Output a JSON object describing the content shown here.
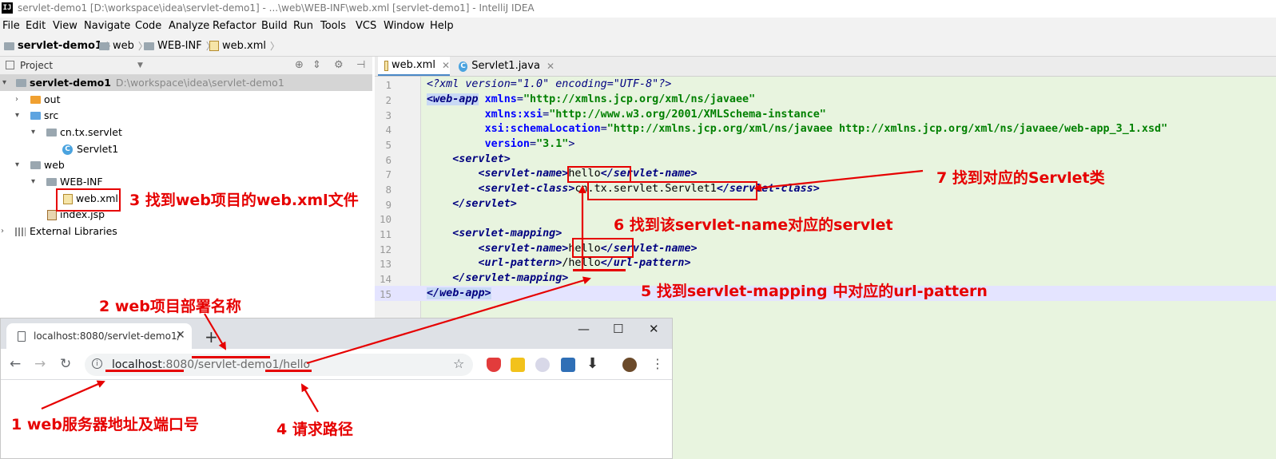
{
  "window": {
    "title": "servlet-demo1 [D:\\workspace\\idea\\servlet-demo1] - ...\\web\\WEB-INF\\web.xml [servlet-demo1] - IntelliJ IDEA",
    "logo_text": "IJ"
  },
  "menu": [
    "File",
    "Edit",
    "View",
    "Navigate",
    "Code",
    "Analyze",
    "Refactor",
    "Build",
    "Run",
    "Tools",
    "VCS",
    "Window",
    "Help"
  ],
  "breadcrumb": [
    "servlet-demo1",
    "web",
    "WEB-INF",
    "web.xml"
  ],
  "project_panel": {
    "title": "Project",
    "tree": [
      {
        "label": "servlet-demo1",
        "path": "D:\\workspace\\idea\\servlet-demo1"
      },
      {
        "label": "out"
      },
      {
        "label": "src"
      },
      {
        "label": "cn.tx.servlet"
      },
      {
        "label": "Servlet1"
      },
      {
        "label": "web"
      },
      {
        "label": "WEB-INF"
      },
      {
        "label": "web.xml"
      },
      {
        "label": "index.jsp"
      },
      {
        "label": "External Libraries"
      }
    ]
  },
  "editor": {
    "tabs": [
      {
        "label": "web.xml",
        "active": true
      },
      {
        "label": "Servlet1.java",
        "active": false
      }
    ],
    "line_numbers": [
      "1",
      "2",
      "3",
      "4",
      "5",
      "6",
      "7",
      "8",
      "9",
      "10",
      "11",
      "12",
      "13",
      "14",
      "15"
    ]
  },
  "browser": {
    "tab_title": "localhost:8080/servlet-demo1/",
    "url_host": "localhost",
    "url_rest": ":8080/servlet-demo1/hello",
    "new_tab_glyph": "+"
  },
  "annotations": {
    "a1": "1 web服务器地址及端口号",
    "a2": "2 web项目部署名称",
    "a3": "3 找到web项目的web.xml文件",
    "a4": "4 请求路径",
    "a5": "5 找到servlet-mapping 中对应的url-pattern",
    "a6": "6 找到该servlet-name对应的servlet",
    "a7": "7  找到对应的Servlet类"
  },
  "colors": {
    "annotation": "#e60000",
    "editor_bg": "#e8f4df",
    "xml_tag": "#000080",
    "xml_attr": "#0000ff",
    "xml_value": "#008000"
  }
}
